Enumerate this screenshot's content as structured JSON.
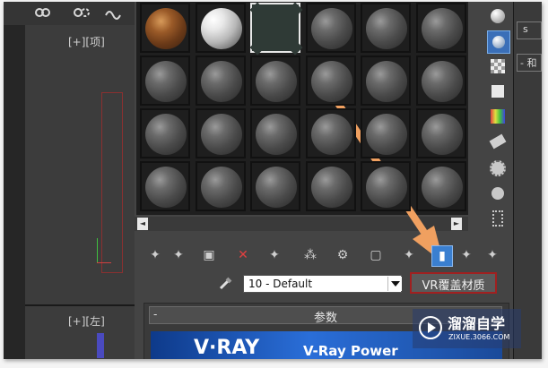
{
  "viewport": {
    "top_left_label": "[+][项]",
    "bottom_left_label": "[+][左]"
  },
  "material_editor": {
    "material_name": "10 - Default",
    "override_button_label": "VR覆盖材质",
    "rollout_label": "参数",
    "rollout_toggle": "-",
    "banner_logo": "V·RAY",
    "banner_text": "V-Ray Power",
    "left_scroll_glyph": "◄",
    "right_scroll_glyph": "►"
  },
  "right_panel": {
    "field1": "s",
    "field2": "- 和"
  },
  "watermark": {
    "name": "溜溜自学",
    "url": "ZIXUE.3066.COM"
  },
  "colors": {
    "arrow": "#f0a060",
    "highlight_box": "#a02020",
    "active_button": "#3a7fd0"
  },
  "icons": [
    "link-icon",
    "unlink-icon",
    "bind-space-warp-icon",
    "delete-icon",
    "put-to-scene-icon",
    "assign-material-icon",
    "reset-icon",
    "make-unique-icon",
    "put-to-library-icon",
    "material-id-channel-icon",
    "show-map-icon",
    "show-end-result-icon",
    "go-to-parent-icon",
    "go-forward-icon",
    "eyedropper-icon",
    "sample-type-icon",
    "backlight-icon",
    "background-icon",
    "uv-tiling-icon",
    "video-color-check-icon",
    "make-preview-icon",
    "options-icon",
    "select-by-material-icon",
    "material-navigator-icon"
  ]
}
